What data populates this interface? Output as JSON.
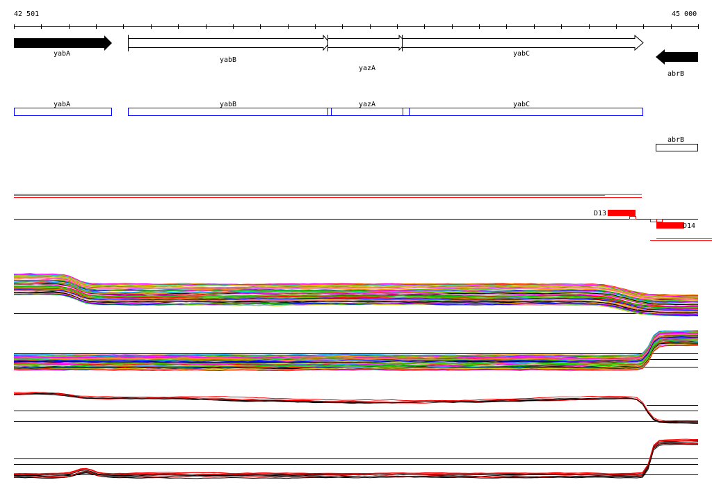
{
  "ruler": {
    "start_label": "42 501",
    "end_label": "45 000",
    "tick_count": 26
  },
  "genes": [
    {
      "name": "yabA",
      "strand": "+",
      "filled": true
    },
    {
      "name": "yabB",
      "strand": "+",
      "filled": false
    },
    {
      "name": "yazA",
      "strand": "+",
      "filled": false
    },
    {
      "name": "yabC",
      "strand": "+",
      "filled": false
    },
    {
      "name": "abrB",
      "strand": "-",
      "filled": true
    }
  ],
  "annotation_boxes": [
    {
      "name": "yabA",
      "color": "#0000ff"
    },
    {
      "name": "yabB",
      "color": "#0000ff"
    },
    {
      "name": "yazA",
      "color": "#0000ff"
    },
    {
      "name": "yabC",
      "color": "#0000ff"
    },
    {
      "name": "abrB",
      "color": "#000000"
    }
  ],
  "features": [
    {
      "label": "D13",
      "color": "#ff0000"
    },
    {
      "label": "D14",
      "color": "#ff0000"
    }
  ],
  "colors": {
    "accent": "#ff0000",
    "gene_box": "#0000ff",
    "green": "#00dd00"
  }
}
